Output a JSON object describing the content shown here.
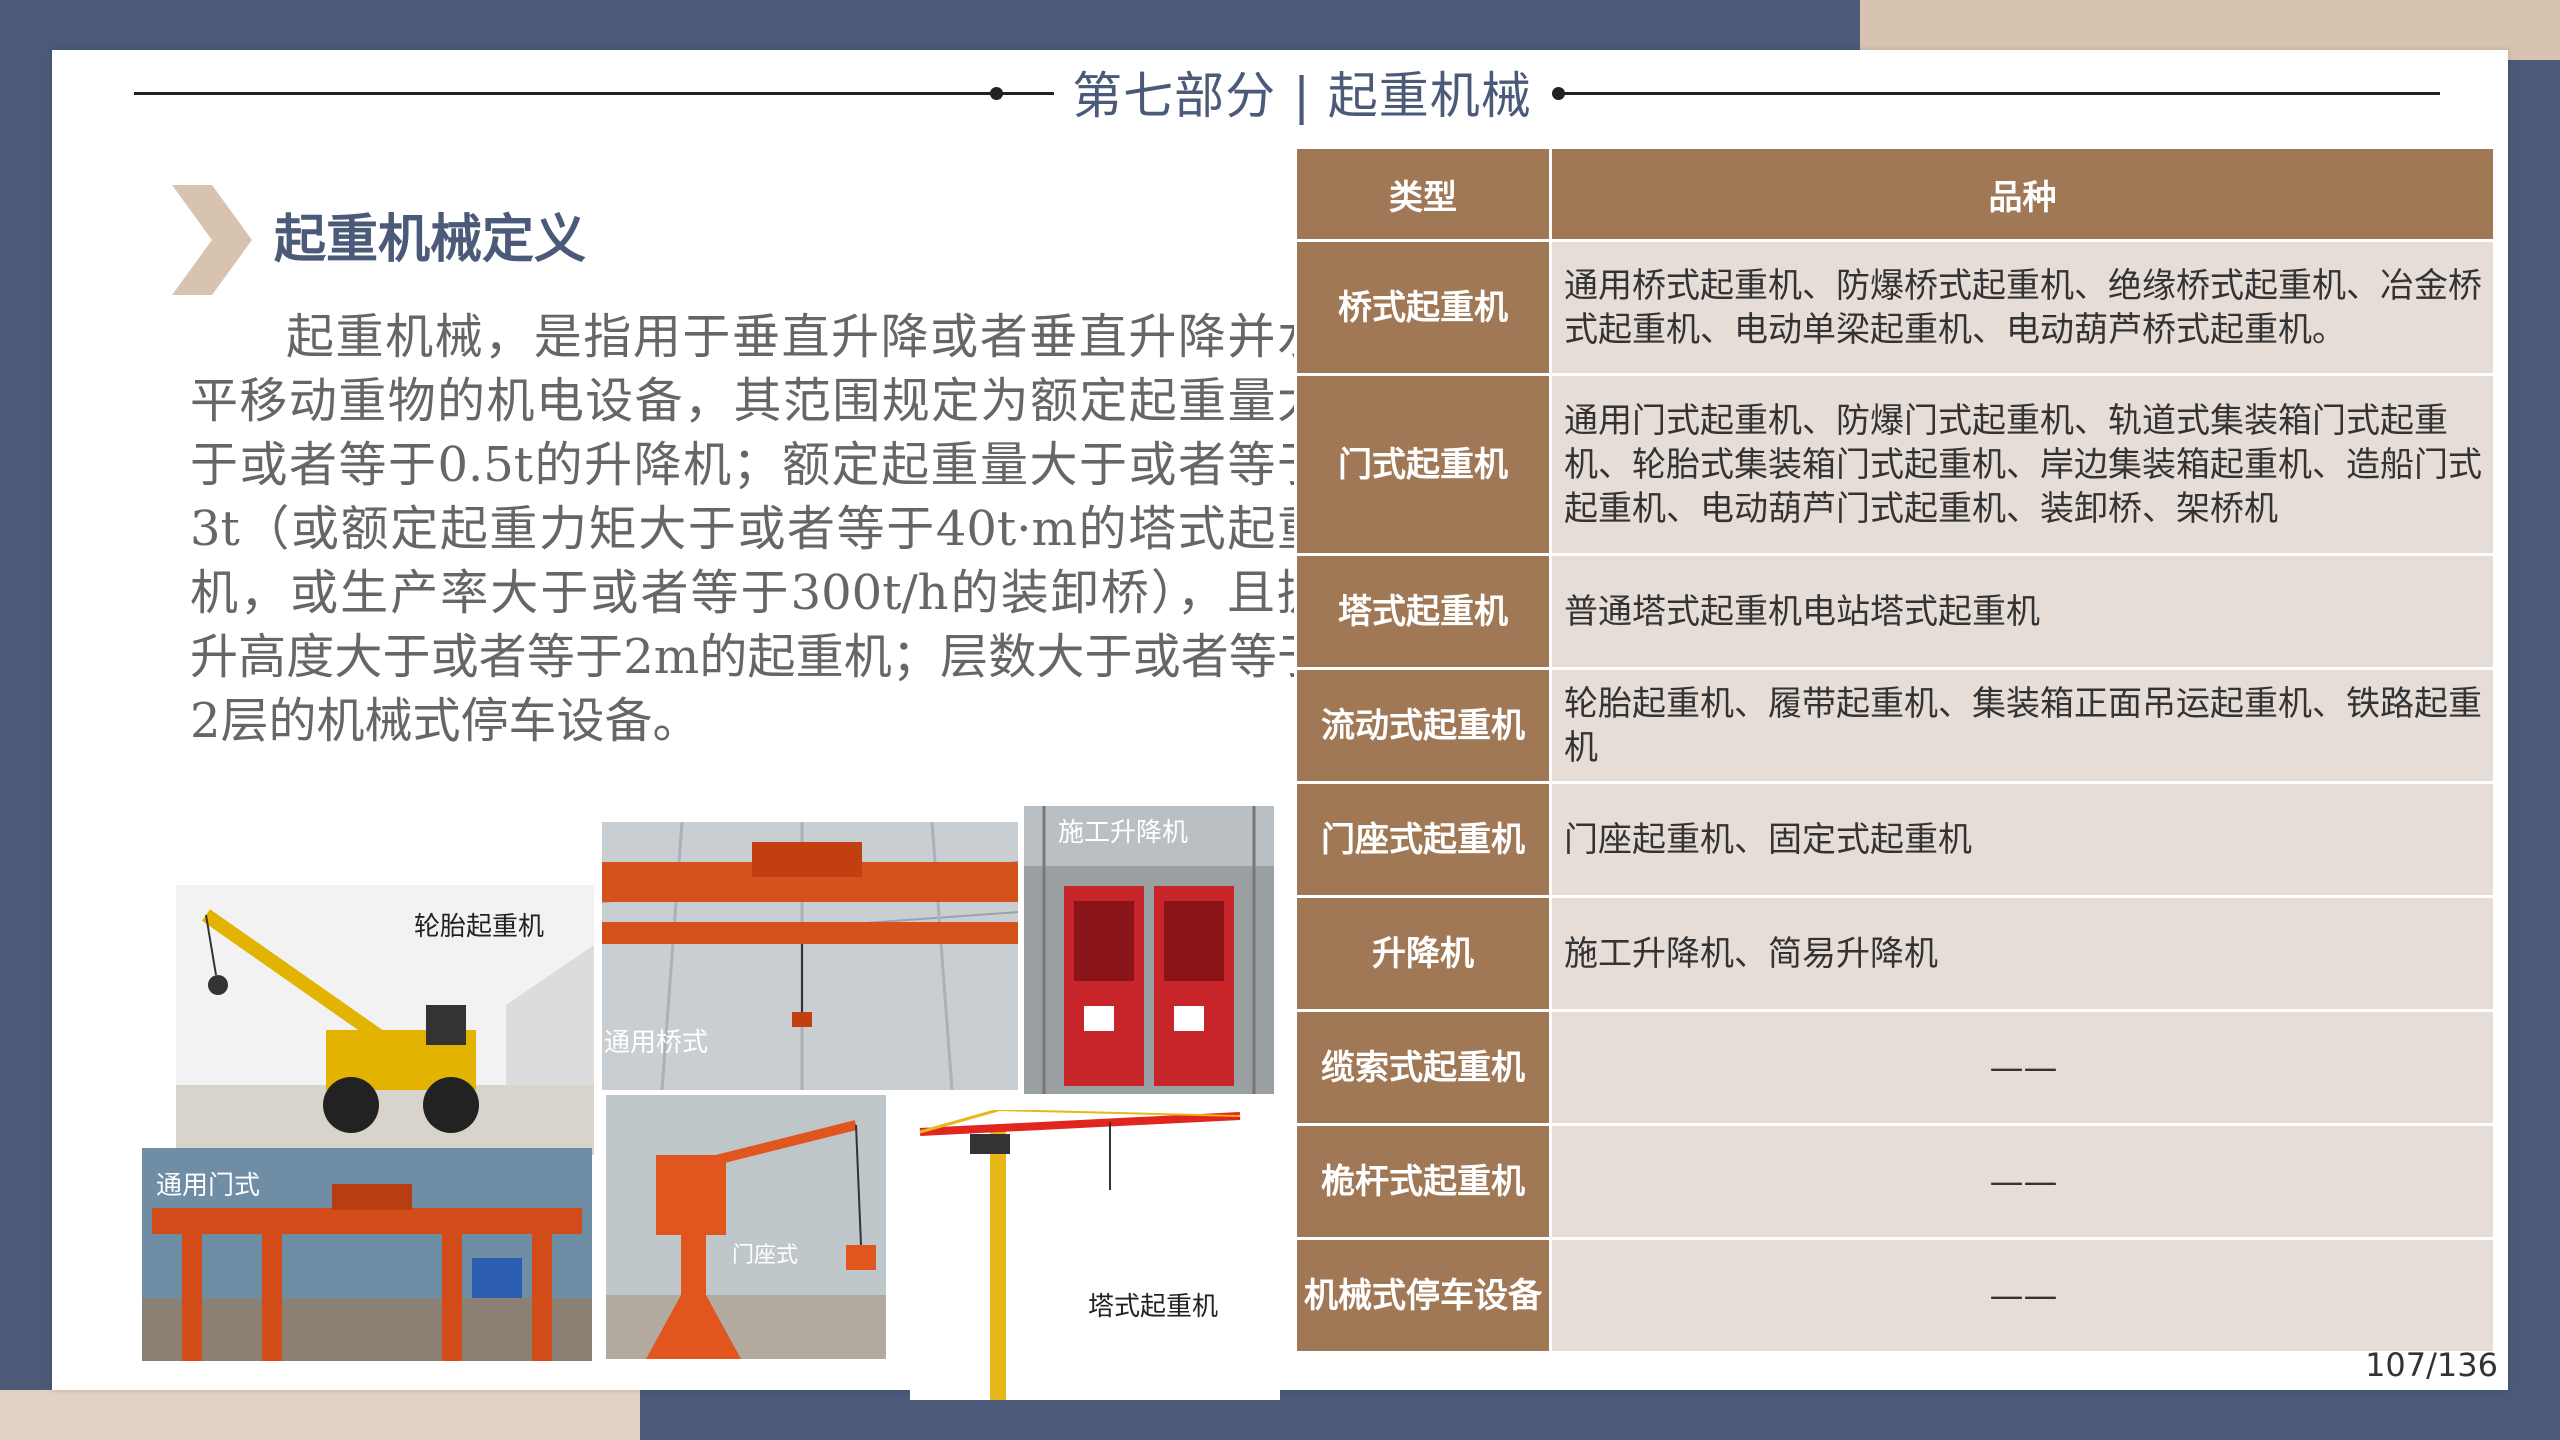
{
  "header": {
    "title": "第七部分 | 起重机械"
  },
  "section": {
    "title": "起重机械定义"
  },
  "definition": "起重机械，是指用于垂直升降或者垂直升降并水平移动重物的机电设备，其范围规定为额定起重量大于或者等于0.5t的升降机；额定起重量大于或者等于3t（或额定起重力矩大于或者等于40t·m的塔式起重机，或生产率大于或者等于300t/h的装卸桥），且提升高度大于或者等于2m的起重机；层数大于或者等于2层的机械式停车设备。",
  "photos": {
    "tire_crane": "轮胎起重机",
    "bridge_crane": "通用桥式",
    "construction_hoist": "施工升降机",
    "gantry_crane": "通用门式",
    "portal_crane": "门座式",
    "tower_crane": "塔式起重机"
  },
  "table": {
    "headers": [
      "类型",
      "品种"
    ],
    "rows": [
      {
        "type": "桥式起重机",
        "varieties": "通用桥式起重机、防爆桥式起重机、绝缘桥式起重机、冶金桥式起重机、电动单梁起重机、电动葫芦桥式起重机。"
      },
      {
        "type": "门式起重机",
        "varieties": "通用门式起重机、防爆门式起重机、轨道式集装箱门式起重机、轮胎式集装箱门式起重机、岸边集装箱起重机、造船门式起重机、电动葫芦门式起重机、装卸桥、架桥机"
      },
      {
        "type": "塔式起重机",
        "varieties": "普通塔式起重机电站塔式起重机"
      },
      {
        "type": "流动式起重机",
        "varieties": "轮胎起重机、履带起重机、集装箱正面吊运起重机、铁路起重机"
      },
      {
        "type": "门座式起重机",
        "varieties": "门座起重机、固定式起重机"
      },
      {
        "type": "升降机",
        "varieties": "施工升降机、简易升降机"
      },
      {
        "type": "缆索式起重机",
        "varieties": "——"
      },
      {
        "type": "桅杆式起重机",
        "varieties": "——"
      },
      {
        "type": "机械式停车设备",
        "varieties": "——"
      }
    ]
  },
  "page": {
    "number": "107/136"
  },
  "colors": {
    "navy": "#4a5a78",
    "brown": "#a07856",
    "cell": "#e6ddd6",
    "tan": "#e2d2c4"
  }
}
